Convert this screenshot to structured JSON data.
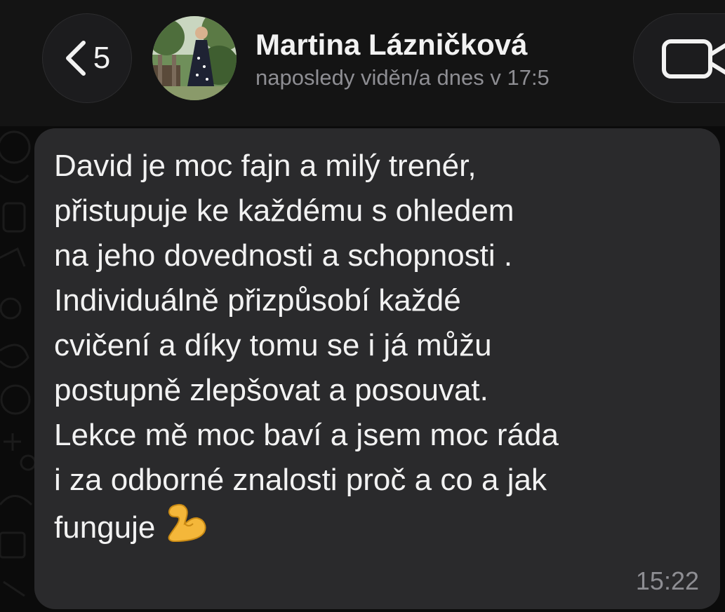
{
  "header": {
    "back_count": "5",
    "contact_name": "Martina Lázničková",
    "contact_status": "naposledy viděn/a dnes v 17:5"
  },
  "message": {
    "lines": [
      "David je moc fajn a milý trenér,",
      "přistupuje ke každému s ohledem",
      "na jeho dovednosti a schopnosti .",
      "Individuálně přizpůsobí každé",
      "cvičení a díky tomu se i já můžu",
      "postupně zlepšovat a posouvat.",
      "Lekce mě moc baví a jsem moc ráda",
      "i za odborné znalosti proč a co a jak",
      "funguje"
    ],
    "emoji": "flexed-biceps-icon",
    "time": "15:22"
  },
  "colors": {
    "background": "#0b0b0b",
    "header": "#141414",
    "bubble": "#2a2a2c",
    "text": "#f2f2f2",
    "secondary_text": "#8e8e93"
  }
}
